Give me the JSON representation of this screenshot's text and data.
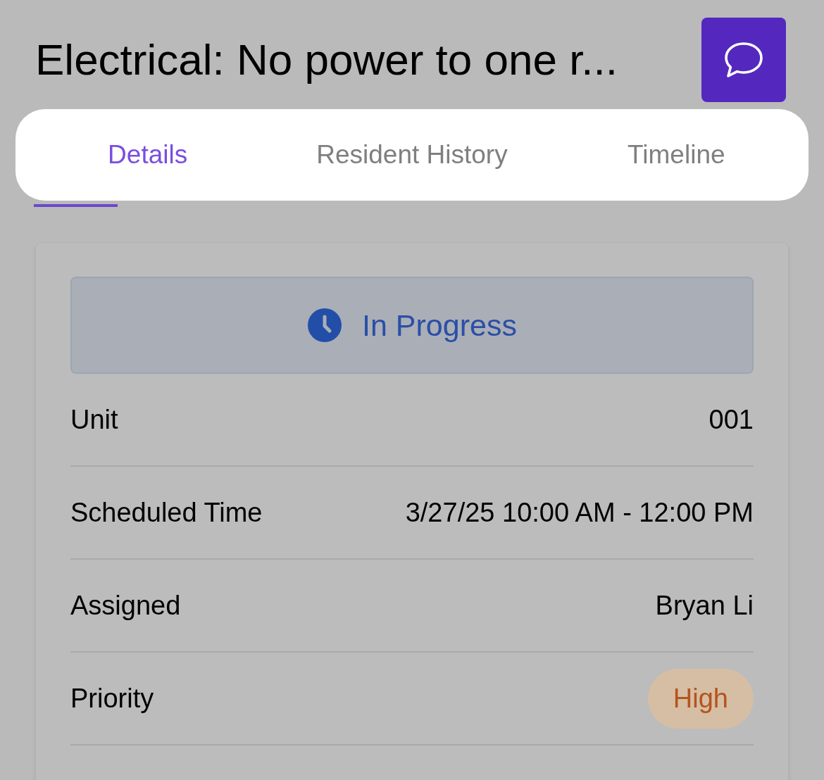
{
  "header": {
    "title": "Electrical: No power to one r..."
  },
  "tabs": [
    {
      "label": "Details",
      "selected": true
    },
    {
      "label": "Resident History",
      "selected": false
    },
    {
      "label": "Timeline",
      "selected": false
    }
  ],
  "status": {
    "label": "In Progress"
  },
  "fields": [
    {
      "kind": "text",
      "label": "Unit",
      "value": "001"
    },
    {
      "kind": "text",
      "label": "Scheduled Time",
      "value": "3/27/25 10:00 AM - 12:00 PM"
    },
    {
      "kind": "text",
      "label": "Assigned",
      "value": "Bryan Li"
    },
    {
      "kind": "badge",
      "label": "Priority",
      "value": "High"
    }
  ]
}
